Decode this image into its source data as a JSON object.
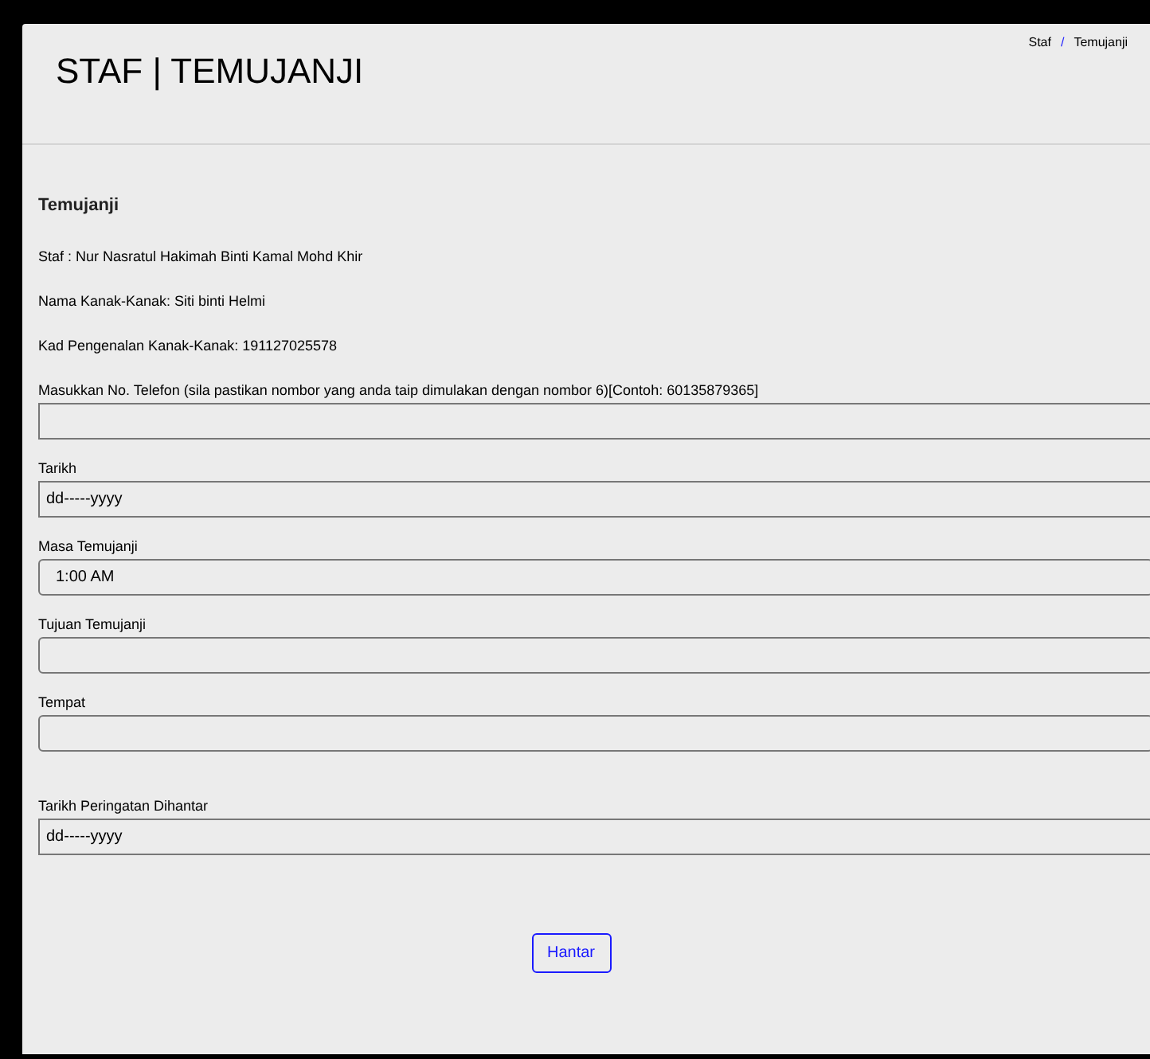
{
  "header": {
    "title": "STAF | TEMUJANJI",
    "breadcrumb": [
      "Staf",
      "Temujanji"
    ],
    "breadcrumb_separator": "/"
  },
  "section_title": "Temujanji",
  "info": [
    "Staf : Nur Nasratul Hakimah Binti Kamal Mohd Khir",
    "Nama Kanak-Kanak: Siti binti Helmi",
    "Kad Pengenalan Kanak-Kanak: 191127025578"
  ],
  "fields": [
    {
      "label": "Masukkan No. Telefon (sila pastikan nombor yang anda taip dimulakan dengan nombor 6)[Contoh: 60135879365]",
      "kind": "text"
    },
    {
      "label": "Tarikh",
      "kind": "date",
      "value": "dd-----yyyy"
    },
    {
      "label": "Masa Temujanji",
      "kind": "time",
      "value": "1:00 AM"
    },
    {
      "label": "Tujuan Temujanji",
      "kind": "text"
    },
    {
      "label": "Tempat",
      "kind": "text"
    },
    {
      "label": "Tarikh Peringatan Dihantar",
      "kind": "date",
      "value": "dd-----yyyy"
    }
  ],
  "submit": "Hantar"
}
